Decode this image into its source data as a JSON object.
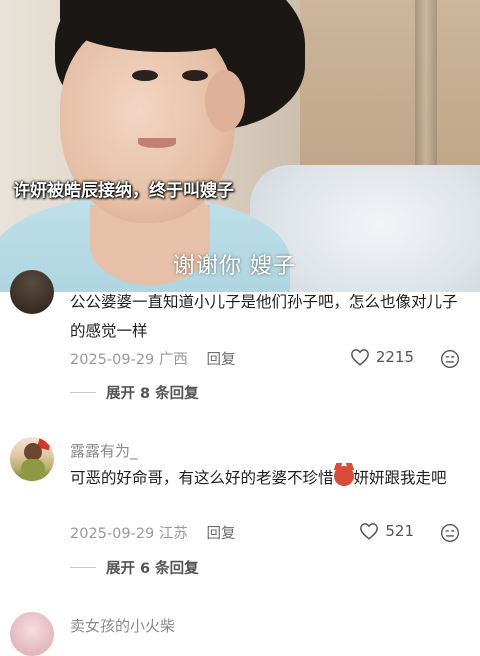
{
  "video": {
    "caption": "许妍被皓辰接纳，终于叫嫂子",
    "subtitle": "谢谢你 嫂子"
  },
  "comments": [
    {
      "username": "",
      "text": "公公婆婆一直知道小儿子是他们孙子吧，怎么也像对儿子的感觉一样",
      "date": "2025-09-29",
      "location": "广西",
      "reply_label": "回复",
      "likes": "2215",
      "expand_label": "展开 8 条回复"
    },
    {
      "username": "露露有为_",
      "text_before": "可恶的好命哥，有这么好的老婆不珍惜",
      "emoji": "angry-face-emoji",
      "text_after": "妍妍跟我走吧",
      "date": "2025-09-29",
      "location": "江苏",
      "reply_label": "回复",
      "likes": "521",
      "expand_label": "展开 6 条回复"
    },
    {
      "username": "卖女孩的小火柴"
    }
  ],
  "icons": {
    "like": "heart-outline-icon",
    "dislike": "dislike-face-icon"
  },
  "colors": {
    "meta_text": "#9a9a9a",
    "body_text": "#1f1f1f"
  }
}
